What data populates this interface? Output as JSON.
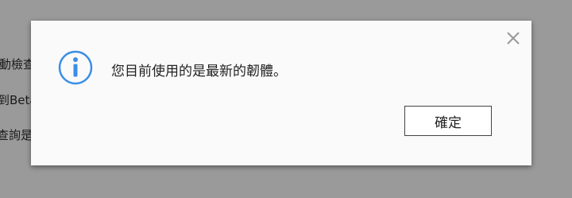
{
  "background": {
    "lines": [
      "動檢查",
      "到Beta",
      "查詢是"
    ]
  },
  "dialog": {
    "message": "您目前使用的是最新的韌體。",
    "ok_label": "確定",
    "info_icon": "info-circle-icon",
    "close_icon": "close-icon",
    "accent_color": "#3a8ee6"
  }
}
